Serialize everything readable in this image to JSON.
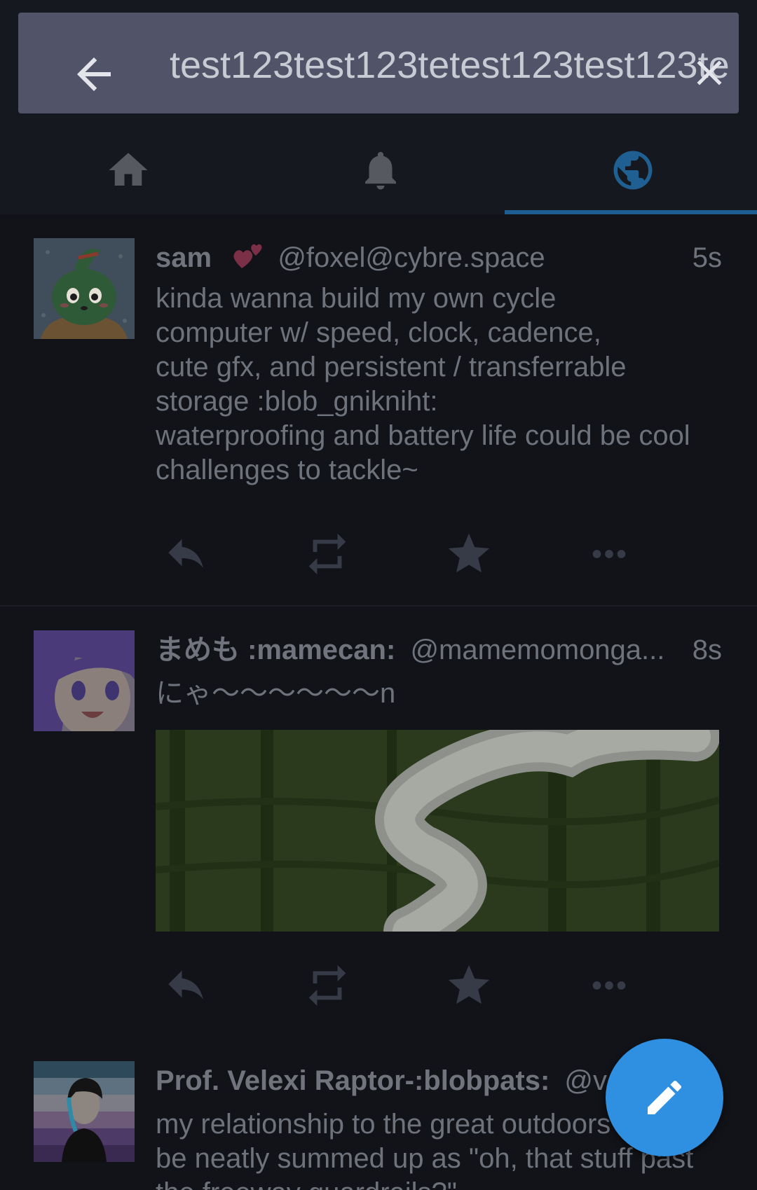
{
  "search": {
    "value": "test123test123tetest123test123te"
  },
  "tabs": [
    {
      "icon": "home-icon"
    },
    {
      "icon": "bell-icon"
    },
    {
      "icon": "globe-icon",
      "active": true
    }
  ],
  "colors": {
    "accent": "#2f8fe0",
    "tab_indicator": "#1d5d8f",
    "searchbar": "#515468"
  },
  "statuses": [
    {
      "display_name": "sam",
      "handle": "@foxel@cybre.space",
      "time": "5s",
      "content_lines": [
        "kinda wanna build my own cycle",
        "computer w/ speed, clock, cadence,",
        "cute gfx, and persistent / transferrable",
        "storage :blob_gnikniht:",
        "waterproofing and battery life could be cool",
        "challenges to tackle~"
      ]
    },
    {
      "display_name": "まめも :mamecan:",
      "handle": "@mamemomonga...",
      "time": "8s",
      "content_lines": [
        "にゃ〜〜〜〜〜〜n"
      ]
    },
    {
      "display_name": "Prof. Velexi Raptor-:blobpats:",
      "handle": "@ve",
      "time": "",
      "content_lines": [
        "my relationship to the great outdoors",
        "be neatly summed up as \"oh, that stuff past",
        "the freeway guardrails?\""
      ]
    }
  ]
}
